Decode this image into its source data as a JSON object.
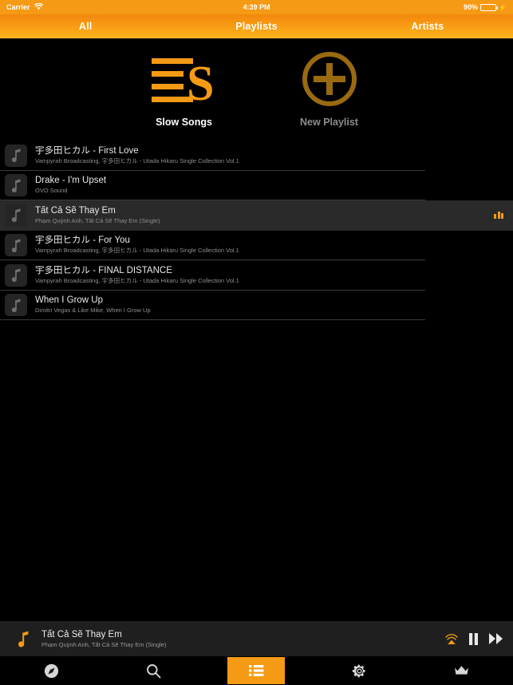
{
  "statusbar": {
    "carrier": "Carrier",
    "wifi_icon": "wifi-icon",
    "time": "4:39 PM",
    "battery_percent": "90%",
    "battery_level": 90,
    "charging_icon": "lightning-bolt-icon"
  },
  "header": {
    "segments": [
      {
        "label": "All",
        "name": "segment-all"
      },
      {
        "label": "Playlists",
        "name": "segment-playlists"
      },
      {
        "label": "Artists",
        "name": "segment-artists"
      }
    ]
  },
  "playlists": [
    {
      "label": "Slow Songs",
      "icon": "playlist-lines-s-icon",
      "state": "active"
    },
    {
      "label": "New Playlist",
      "icon": "plus-circle-icon",
      "state": "muted"
    }
  ],
  "tracks": [
    {
      "title": "宇多田ヒカル - First Love",
      "subtitle": "Vampyrah Broadcasting, 宇多田ヒカル - Utada Hikaru Single Collection Vol.1",
      "selected": false
    },
    {
      "title": "Drake - I'm Upset",
      "subtitle": "OVO Sound",
      "selected": false
    },
    {
      "title": "Tất Cả Sẽ Thay Em",
      "subtitle": "Phạm Quỳnh Anh, Tất Cả Sẽ Thay Em (Single)",
      "selected": true
    },
    {
      "title": "宇多田ヒカル - For You",
      "subtitle": "Vampyrah Broadcasting, 宇多田ヒカル - Utada Hikaru Single Collection Vol.1",
      "selected": false
    },
    {
      "title": "宇多田ヒカル - FINAL DISTANCE",
      "subtitle": "Vampyrah Broadcasting, 宇多田ヒカル - Utada Hikaru Single Collection Vol.1",
      "selected": false
    },
    {
      "title": "When I Grow Up",
      "subtitle": "Dimitri Vegas & Like Mike, When I Grow Up",
      "selected": false
    }
  ],
  "now_playing": {
    "title": "Tất Cả Sẽ Thay Em",
    "subtitle": "Phạm Quỳnh Anh, Tất Cả Sẽ Thay Em (Single)",
    "note_icon": "music-note-icon",
    "airplay_icon": "airplay-icon",
    "pause_icon": "pause-icon",
    "next_icon": "fast-forward-icon"
  },
  "tabbar": [
    {
      "name": "tab-explore",
      "icon": "compass-icon",
      "active": false
    },
    {
      "name": "tab-search",
      "icon": "search-icon",
      "active": false
    },
    {
      "name": "tab-library",
      "icon": "list-icon",
      "active": true
    },
    {
      "name": "tab-settings",
      "icon": "gear-icon",
      "active": false
    },
    {
      "name": "tab-premium",
      "icon": "crown-icon",
      "active": false
    }
  ],
  "colors": {
    "accent": "#f59a14",
    "header_top": "#f2880d",
    "header_bottom": "#ffb51f",
    "background": "#000000",
    "row_selected": "#2a2a2a",
    "battery_green": "#4cd337"
  }
}
